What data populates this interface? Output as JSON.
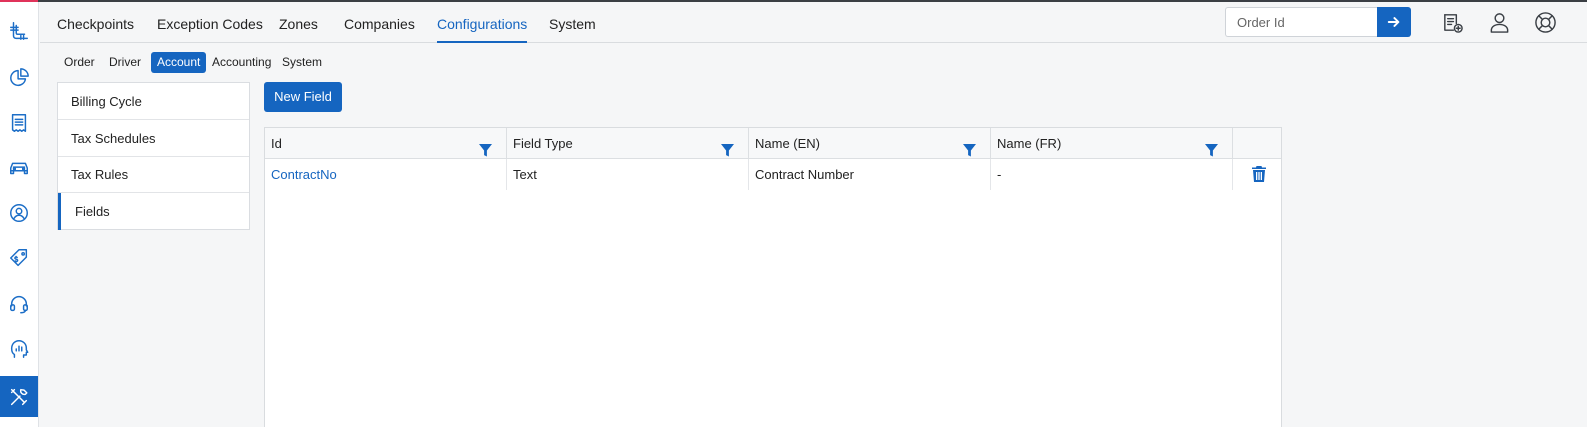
{
  "top_nav": {
    "tabs": [
      {
        "label": "Checkpoints"
      },
      {
        "label": "Exception Codes"
      },
      {
        "label": "Zones"
      },
      {
        "label": "Companies"
      },
      {
        "label": "Configurations",
        "active": true
      },
      {
        "label": "System"
      }
    ],
    "order_search": {
      "placeholder": "Order Id",
      "value": ""
    },
    "icons": [
      "order-go-arrow-icon",
      "new-order-document-icon",
      "user-profile-icon",
      "help-lifebuoy-icon"
    ]
  },
  "left_rail": {
    "items": [
      {
        "icon": "logo-icon"
      },
      {
        "icon": "pie-chart-icon"
      },
      {
        "icon": "receipt-icon"
      },
      {
        "icon": "car-icon"
      },
      {
        "icon": "user-circle-icon"
      },
      {
        "icon": "price-tag-icon"
      },
      {
        "icon": "headset-icon"
      },
      {
        "icon": "head-analytics-icon"
      },
      {
        "icon": "tools-icon",
        "active": true
      }
    ]
  },
  "sub_tabs": [
    {
      "label": "Order"
    },
    {
      "label": "Driver"
    },
    {
      "label": "Account",
      "active": true
    },
    {
      "label": "Accounting"
    },
    {
      "label": "System"
    }
  ],
  "side_menu": [
    {
      "label": "Billing Cycle"
    },
    {
      "label": "Tax Schedules"
    },
    {
      "label": "Tax Rules"
    },
    {
      "label": "Fields",
      "active": true
    }
  ],
  "new_field_label": "New Field",
  "table": {
    "columns": [
      "Id",
      "Field Type",
      "Name (EN)",
      "Name (FR)"
    ],
    "rows": [
      {
        "id": "ContractNo",
        "field_type": "Text",
        "name_en": "Contract Number",
        "name_fr": "-"
      }
    ]
  },
  "colors": {
    "accent": "#1565c0",
    "brand_stripe": "#e0335a"
  }
}
